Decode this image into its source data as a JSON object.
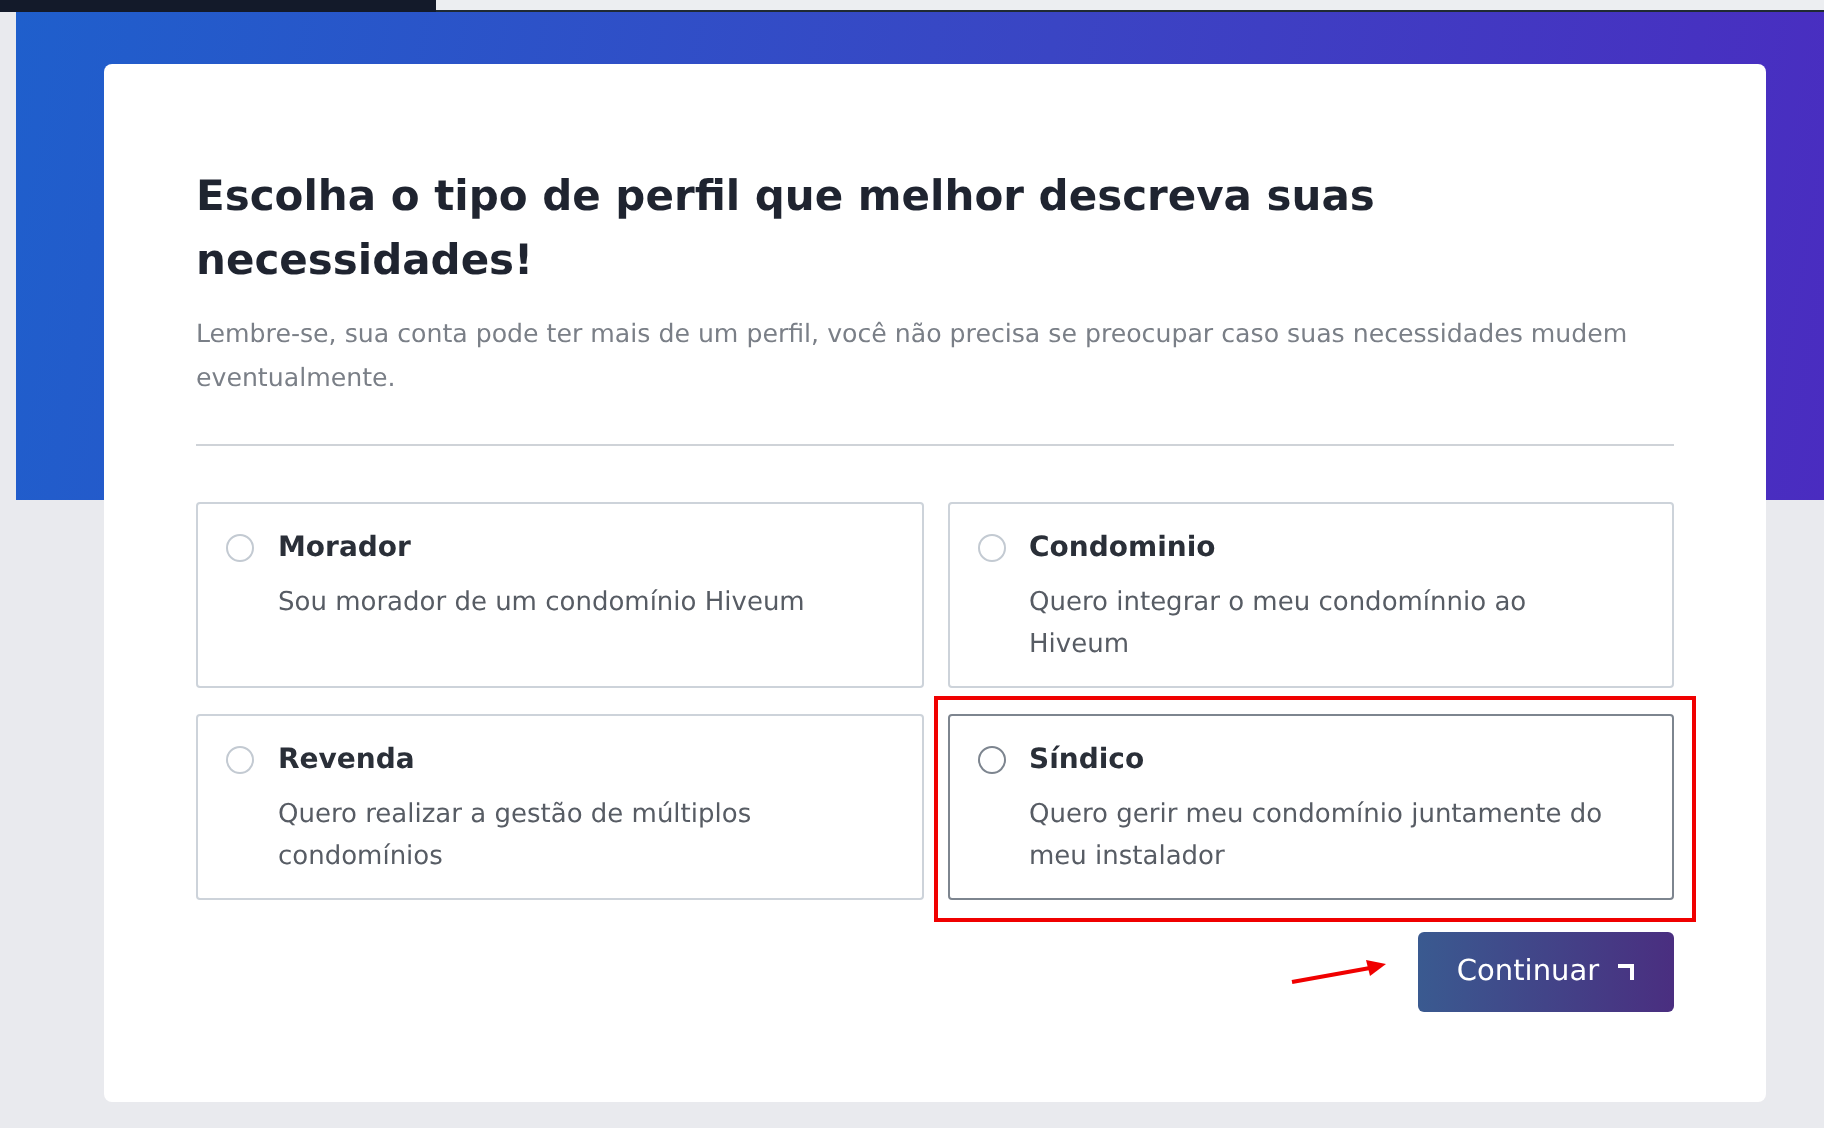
{
  "title": "Escolha o tipo de perfil que melhor descreva suas necessidades!",
  "subtitle": "Lembre-se, sua conta pode ter mais de um perfil, você não precisa se preocupar caso suas necessidades mudem eventualmente.",
  "options": [
    {
      "label": "Morador",
      "description": "Sou morador de um condomínio Hiveum",
      "selected": false,
      "highlighted": false
    },
    {
      "label": "Condominio",
      "description": "Quero integrar o meu condomínnio ao Hiveum",
      "selected": false,
      "highlighted": false
    },
    {
      "label": "Revenda",
      "description": "Quero realizar a gestão de múltiplos condomínios",
      "selected": false,
      "highlighted": false
    },
    {
      "label": "Síndico",
      "description": "Quero gerir meu condomínio juntamente do meu instalador",
      "selected": false,
      "highlighted": true
    }
  ],
  "continue_button": {
    "label": "Continuar",
    "highlighted": true
  }
}
